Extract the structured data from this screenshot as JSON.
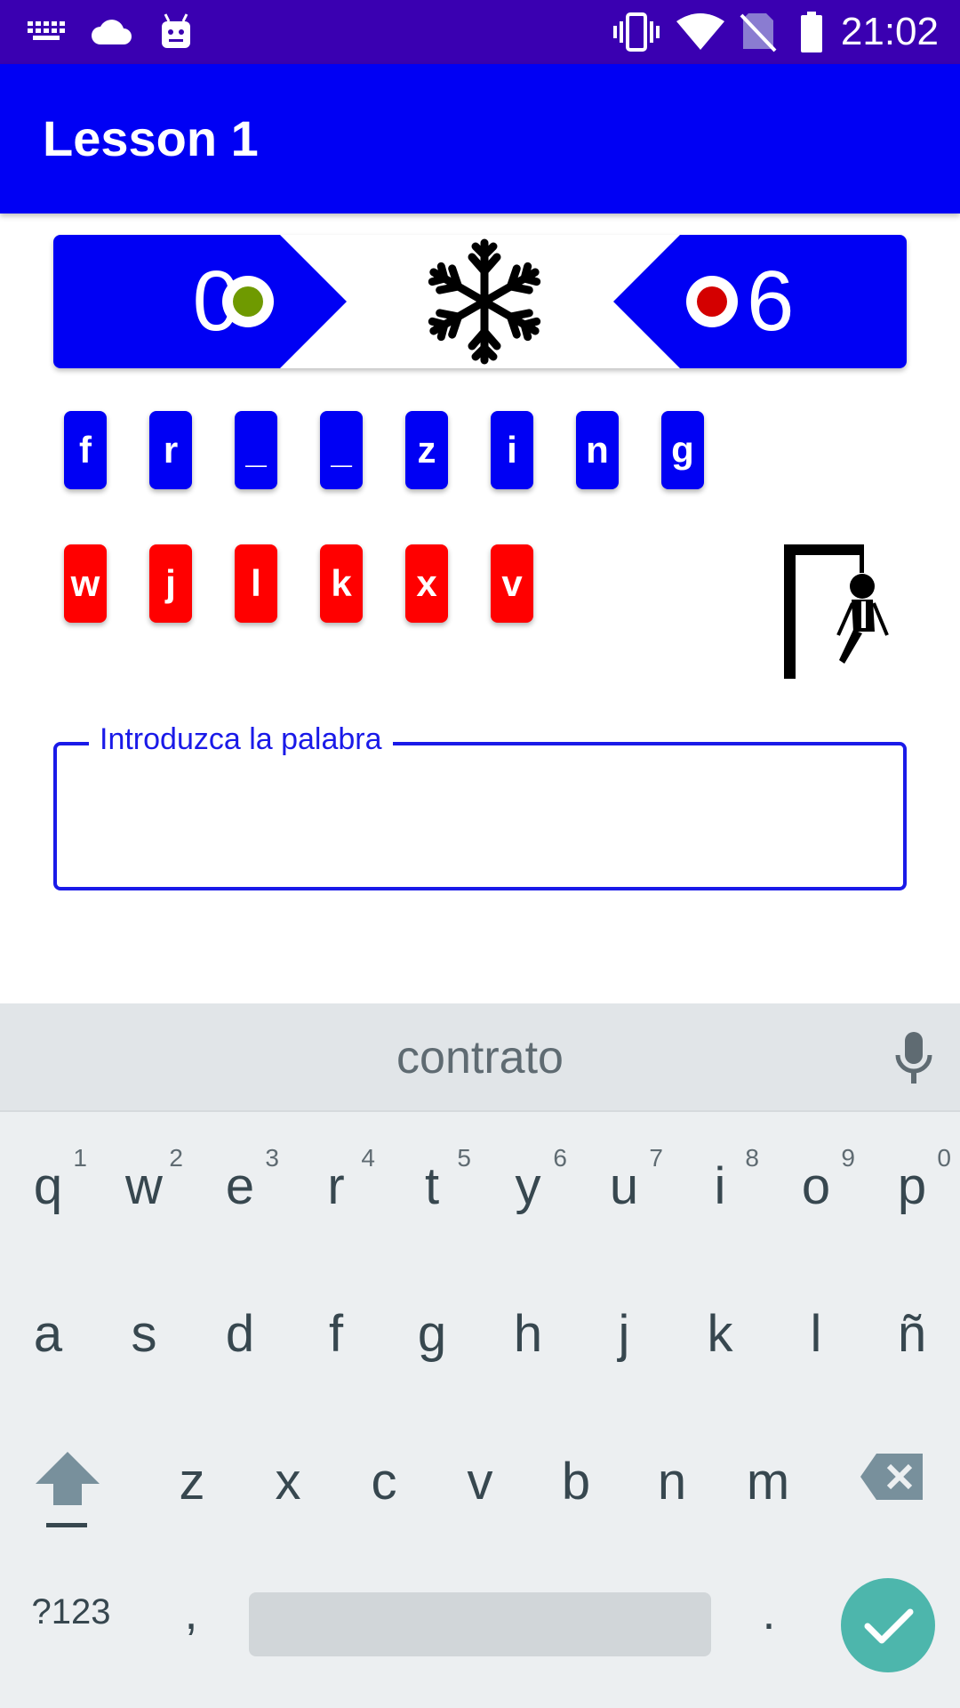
{
  "status_bar": {
    "time": "21:02",
    "icons": [
      "keyboard-icon",
      "cloud-icon",
      "android-icon",
      "vibrate-icon",
      "wifi-icon",
      "no-sim-icon",
      "battery-icon"
    ]
  },
  "app_bar": {
    "title": "Lesson 1"
  },
  "score": {
    "left_value": "0",
    "right_value": "6",
    "left_dot_color": "#6f9a00",
    "right_dot_color": "#d40000",
    "center_icon": "snowflake-icon"
  },
  "word_letters": [
    "f",
    "r",
    "_",
    "_",
    "z",
    "i",
    "n",
    "g"
  ],
  "wrong_letters": [
    "w",
    "j",
    "l",
    "k",
    "x",
    "v"
  ],
  "hangman_icon": "hangman-icon",
  "input": {
    "label": "Introduzca la palabra",
    "value": ""
  },
  "keyboard": {
    "suggestion": "contrato",
    "row1": [
      "q",
      "w",
      "e",
      "r",
      "t",
      "y",
      "u",
      "i",
      "o",
      "p"
    ],
    "row1_hints": [
      "1",
      "2",
      "3",
      "4",
      "5",
      "6",
      "7",
      "8",
      "9",
      "0"
    ],
    "row2": [
      "a",
      "s",
      "d",
      "f",
      "g",
      "h",
      "j",
      "k",
      "l",
      "ñ"
    ],
    "row3": [
      "z",
      "x",
      "c",
      "v",
      "b",
      "n",
      "m"
    ],
    "symbols_label": "?123",
    "comma_label": ",",
    "period_label": "."
  },
  "colors": {
    "status_bar": "#3a00b1",
    "primary": "#0000f4",
    "wrong": "#ff0000",
    "field_accent": "#1a1ae8",
    "enter_key": "#4db6ac"
  }
}
